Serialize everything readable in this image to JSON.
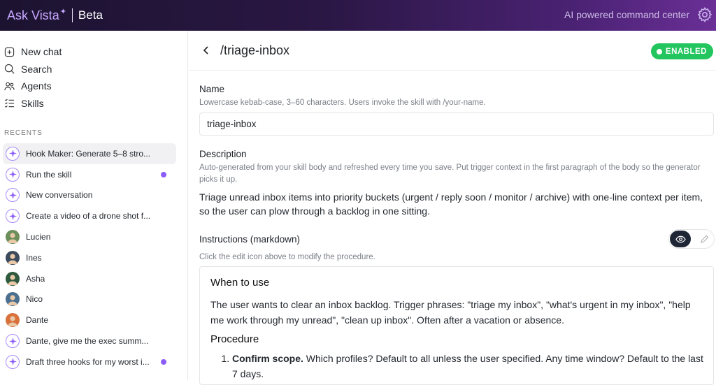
{
  "app": {
    "brand": "Ask Vista",
    "beta": "Beta",
    "subtitle": "AI powered command center"
  },
  "sidebar": {
    "nav": [
      {
        "label": "New chat",
        "icon": "plus-square-icon"
      },
      {
        "label": "Search",
        "icon": "search-icon"
      },
      {
        "label": "Agents",
        "icon": "users-icon"
      },
      {
        "label": "Skills",
        "icon": "list-check-icon"
      }
    ],
    "recents_label": "RECENTS",
    "recents": [
      {
        "label": "Hook Maker: Generate 5–8 stro...",
        "avatar": "spark",
        "active": true,
        "unread": false
      },
      {
        "label": "Run the skill",
        "avatar": "spark",
        "active": false,
        "unread": true
      },
      {
        "label": "New conversation",
        "avatar": "spark",
        "active": false,
        "unread": false
      },
      {
        "label": "Create a video of a drone shot f...",
        "avatar": "spark",
        "active": false,
        "unread": false
      },
      {
        "label": "Lucien",
        "avatar": "person",
        "color": "#6b8e5a",
        "active": false,
        "unread": false
      },
      {
        "label": "Ines",
        "avatar": "person",
        "color": "#3b4a5c",
        "active": false,
        "unread": false
      },
      {
        "label": "Asha",
        "avatar": "person",
        "color": "#2f5a3e",
        "active": false,
        "unread": false
      },
      {
        "label": "Nico",
        "avatar": "person",
        "color": "#4a6f8f",
        "active": false,
        "unread": false
      },
      {
        "label": "Dante",
        "avatar": "person",
        "color": "#d9713a",
        "active": false,
        "unread": false
      },
      {
        "label": "Dante, give me the exec summ...",
        "avatar": "spark",
        "active": false,
        "unread": false
      },
      {
        "label": "Draft three hooks for my worst i...",
        "avatar": "spark",
        "active": false,
        "unread": true
      }
    ]
  },
  "main": {
    "title": "/triage-inbox",
    "badge": "ENABLED",
    "name": {
      "label": "Name",
      "hint": "Lowercase kebab-case, 3–60 characters. Users invoke the skill with /your-name.",
      "value": "triage-inbox"
    },
    "description": {
      "label": "Description",
      "hint": "Auto-generated from your skill body and refreshed every time you save. Put trigger context in the first paragraph of the body so the generator picks it up.",
      "value": "Triage unread inbox items into priority buckets (urgent / reply soon / monitor / archive) with one-line context per item, so the user can plow through a backlog in one sitting."
    },
    "instructions": {
      "label": "Instructions (markdown)",
      "hint": "Click the edit icon above to modify the procedure.",
      "h1": "When to use",
      "p1": "The user wants to clear an inbox backlog. Trigger phrases: \"triage my inbox\", \"what's urgent in my inbox\", \"help me work through my unread\", \"clean up inbox\". Often after a vacation or absence.",
      "h2": "Procedure",
      "step1_bold": "Confirm scope.",
      "step1_text": " Which profiles? Default to all unless the user specified. Any time window? Default to the last 7 days."
    }
  },
  "colors": {
    "accent": "#8b5cf6",
    "enabled": "#22c55e",
    "toggle_active": "#1e2535"
  }
}
